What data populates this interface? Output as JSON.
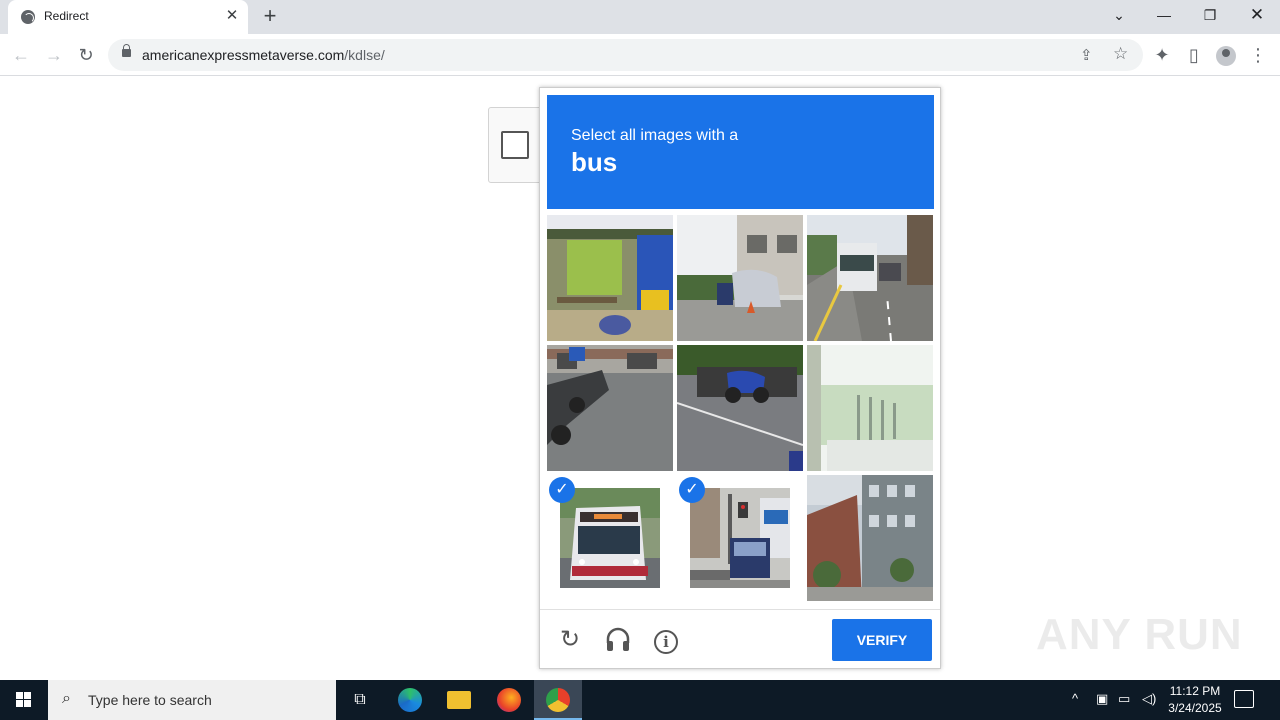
{
  "browser": {
    "tab_title": "Redirect",
    "tab_close": "✕",
    "new_tab": "+",
    "url_host": "americanexpressmetaverse.com",
    "url_path": "/kdlse/",
    "window_controls": {
      "tab_search": "⌄",
      "minimize": "—",
      "restore": "❐",
      "close": "✕"
    },
    "nav": {
      "back": "←",
      "forward": "→",
      "reload": "↻"
    },
    "toolbar_icons": {
      "share": "⇪",
      "star": "☆",
      "extensions": "✦",
      "side_panel": "▯",
      "menu": "⋮"
    }
  },
  "captcha": {
    "prompt": "Select all images with a",
    "target": "bus",
    "verify_label": "VERIFY",
    "icons": {
      "reload": "↻",
      "audio": "🎧",
      "info": "i",
      "check": "✓"
    },
    "tiles": [
      {
        "id": "tile-1",
        "selected": false,
        "scene": "bus-stop"
      },
      {
        "id": "tile-2",
        "selected": false,
        "scene": "street-houses"
      },
      {
        "id": "tile-3",
        "selected": false,
        "scene": "bus-highway"
      },
      {
        "id": "tile-4",
        "selected": false,
        "scene": "parked-motorbikes"
      },
      {
        "id": "tile-5",
        "selected": false,
        "scene": "motorbikes-road"
      },
      {
        "id": "tile-6",
        "selected": false,
        "scene": "street-lights"
      },
      {
        "id": "tile-7",
        "selected": true,
        "scene": "bus-front"
      },
      {
        "id": "tile-8",
        "selected": true,
        "scene": "bus-street"
      },
      {
        "id": "tile-9",
        "selected": false,
        "scene": "buildings"
      }
    ]
  },
  "watermark": "ANY RUN",
  "taskbar": {
    "search_placeholder": "Type here to search",
    "time": "11:12 PM",
    "date": "3/24/2025",
    "apps": [
      "task-view",
      "edge",
      "file-explorer",
      "firefox",
      "chrome"
    ]
  },
  "colors": {
    "accent": "#1a73e8",
    "taskbar": "#0d1a26"
  }
}
